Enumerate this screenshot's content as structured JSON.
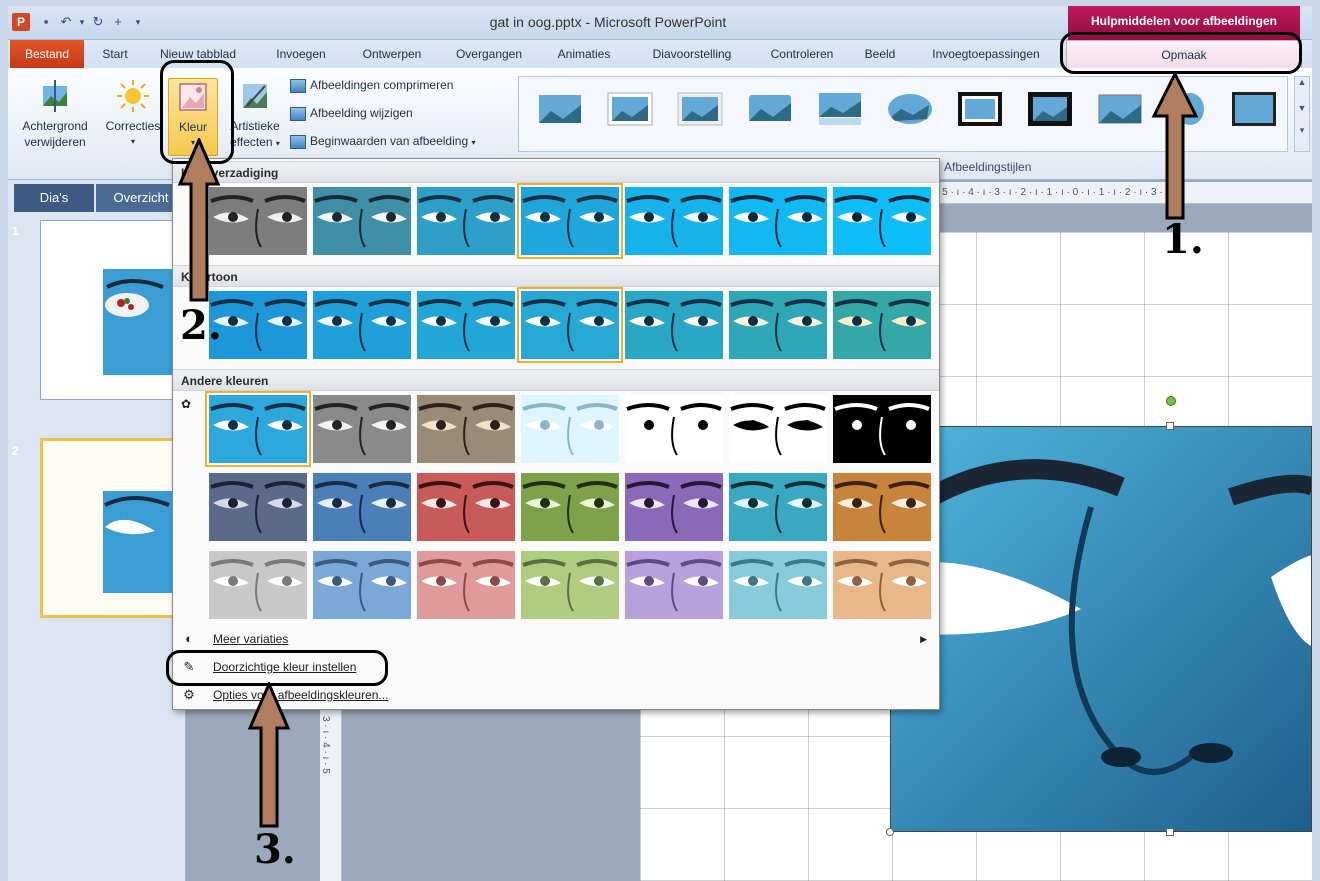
{
  "window": {
    "title": "gat in oog.pptx - Microsoft PowerPoint",
    "app_icon": "P",
    "context_tab_group": "Hulpmiddelen voor afbeeldingen"
  },
  "tabs": [
    {
      "label": "Bestand"
    },
    {
      "label": "Start"
    },
    {
      "label": "Nieuw tabblad"
    },
    {
      "label": "Invoegen"
    },
    {
      "label": "Ontwerpen"
    },
    {
      "label": "Overgangen"
    },
    {
      "label": "Animaties"
    },
    {
      "label": "Diavoorstelling"
    },
    {
      "label": "Controleren"
    },
    {
      "label": "Beeld"
    },
    {
      "label": "Invoegtoepassingen"
    },
    {
      "label": "Opmaak"
    }
  ],
  "ribbon": {
    "remove_background": "Achtergrond verwijderen",
    "corrections": "Correcties",
    "color": "Kleur",
    "artistic_effects": "Artistieke effecten",
    "compress": "Afbeeldingen comprimeren",
    "change_picture": "Afbeelding wijzigen",
    "reset_picture": "Beginwaarden van afbeelding",
    "styles_group": "Afbeeldingstijlen"
  },
  "pane": {
    "tab_slides": "Dia's",
    "tab_outline": "Overzicht",
    "slides": [
      {
        "number": "1"
      },
      {
        "number": "2"
      }
    ]
  },
  "ruler": {
    "top_scale": "· 5 · ı · 4 · ı · 3 · ı · 2 · ı · 1 · ı · 0 · ı · 1 · ı · 2 · ı · 3 ·",
    "left_scale": "3 · ı · 4 · ı · 5"
  },
  "color_menu": {
    "saturation_header": "Kleurverzadiging",
    "tone_header": "Kleurtoon",
    "recolor_header": "Andere kleuren",
    "more_variations": "Meer variaties",
    "set_transparent": "Doorzichtige kleur instellen",
    "options": "Opties voor afbeeldingskleuren..."
  },
  "annotations": {
    "step1": "1.",
    "step2": "2.",
    "step3": "3."
  },
  "colors": {
    "accent_file_tab": "#d24726",
    "context_tab": "#a0124f",
    "selected_highlight": "#e8b42c",
    "annotation_arrow": "#b07d5e"
  }
}
